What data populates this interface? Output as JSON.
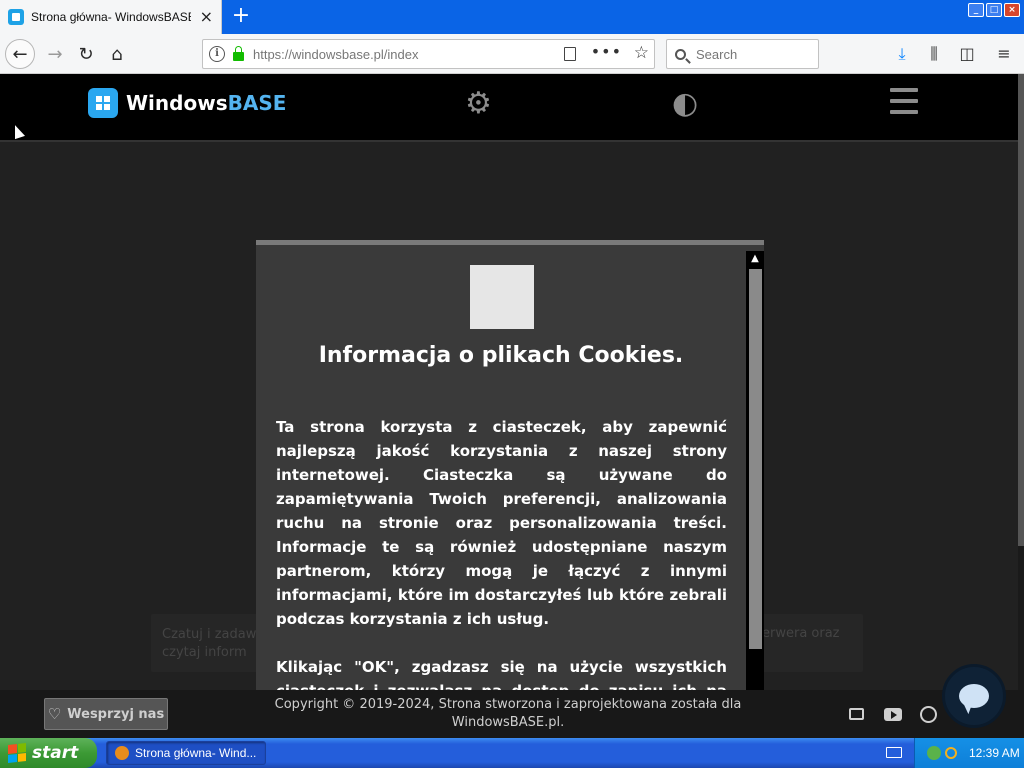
{
  "browser": {
    "tab_title": "Strona główna- WindowsBASE.pl",
    "tab_close_icon": "close-icon",
    "new_tab_label": "+",
    "window_buttons": {
      "minimize": "_",
      "maximize": "□",
      "close": "×"
    },
    "url": "https://windowsbase.pl/index",
    "search_placeholder": "Search",
    "icons": [
      "back-icon",
      "forward-icon",
      "reload-icon",
      "home-icon",
      "info-icon",
      "lock-icon",
      "reader-view-icon",
      "page-actions-icon",
      "bookmark-star-icon",
      "download-icon",
      "library-icon",
      "sidebar-icon",
      "menu-icon"
    ],
    "nav_glyphs": {
      "back": "←",
      "forward": "→",
      "reload": "↻",
      "home": "⌂",
      "dots": "•••",
      "star": "☆",
      "download": "⤓",
      "library": "⫼",
      "sidebar": "◫",
      "menu": "≡",
      "info": "i"
    }
  },
  "site": {
    "brand_prefix": "Windows",
    "brand_accent": "BASE",
    "accent_color": "#54b4f0",
    "settings_icon": "⚙",
    "contrast_icon": "◐",
    "background_text_left": "Czatuj i zadaw",
    "background_text_left_2": "czytaj inform",
    "background_text_right": "erwera oraz"
  },
  "cookie_modal": {
    "title": "Informacja o plikach Cookies.",
    "paragraph_1": "Ta strona korzysta z ciasteczek, aby zapewnić najlepszą jakość korzystania z naszej strony internetowej. Ciasteczka są używane do zapamiętywania Twoich preferencji, analizowania ruchu na stronie oraz personalizowania treści. Informacje te są również udostępniane naszym partnerom, którzy mogą je łączyć z innymi informacjami, które im dostarczyłeś lub które zebrali podczas korzystania z ich usług.",
    "paragraph_2": "Klikając \"OK\", zgadzasz się na użycie wszystkich ciasteczek i zezwalasz na dostęp do zapisu ich na twoim urządzeniu.",
    "scroll_up_glyph": "▲"
  },
  "footer": {
    "support_label": "Wesprzyj nas",
    "heart_glyph": "♡",
    "copyright_line_1": "Copyright © 2019-2024, Strona stworzona i zaprojektowana została dla",
    "copyright_line_2": "WindowsBASE.pl."
  },
  "taskbar": {
    "start_label": "start",
    "task_label": "Strona główna- Wind...",
    "clock": "12:39 AM",
    "xp_logo_colors": [
      "#f25022",
      "#7fba00",
      "#00a4ef",
      "#ffb900"
    ]
  }
}
